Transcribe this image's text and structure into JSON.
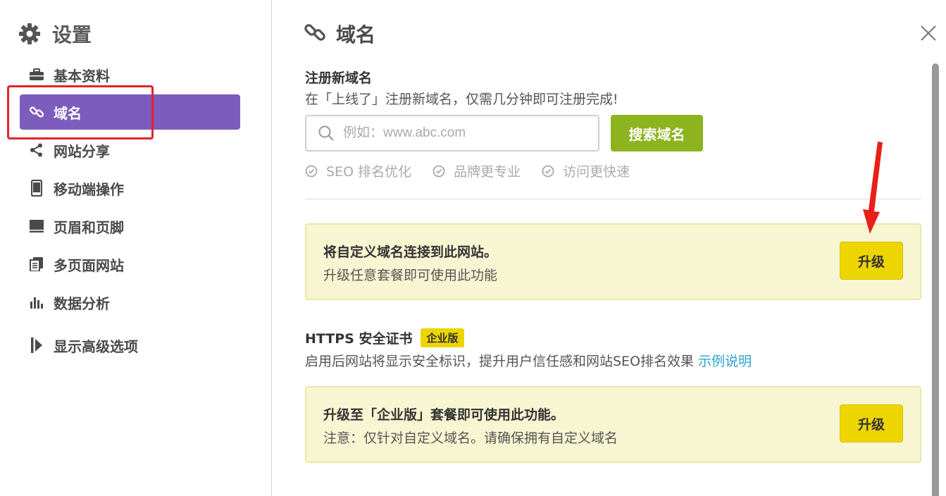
{
  "sidebar": {
    "title": "设置",
    "items": [
      {
        "label": "基本资料",
        "icon": "briefcase-icon"
      },
      {
        "label": "域名",
        "icon": "link-icon",
        "active": true
      },
      {
        "label": "网站分享",
        "icon": "share-icon"
      },
      {
        "label": "移动端操作",
        "icon": "mobile-icon"
      },
      {
        "label": "页眉和页脚",
        "icon": "header-footer-icon"
      },
      {
        "label": "多页面网站",
        "icon": "pages-icon"
      },
      {
        "label": "数据分析",
        "icon": "bar-chart-icon"
      },
      {
        "label": "显示高级选项",
        "icon": "expand-icon"
      }
    ]
  },
  "main": {
    "title": "域名",
    "register": {
      "title": "注册新域名",
      "desc": "在「上线了」注册新域名，仅需几分钟即可注册完成!",
      "search_placeholder": "例如：www.abc.com",
      "search_button": "搜索域名",
      "features": [
        "SEO 排名优化",
        "品牌更专业",
        "访问更快速"
      ]
    },
    "custom_domain_card": {
      "title": "将自定义域名连接到此网站。",
      "desc": "升级任意套餐即可使用此功能",
      "button": "升级"
    },
    "https": {
      "title": "HTTPS 安全证书",
      "badge": "企业版",
      "desc": "启用后网站将显示安全标识，提升用户信任感和网站SEO排名效果",
      "link": "示例说明"
    },
    "https_card": {
      "title": "升级至「企业版」套餐即可使用此功能。",
      "desc": "注意：仅针对自定义域名。请确保拥有自定义域名",
      "button": "升级"
    }
  },
  "colors": {
    "accent": "#7c5cbd",
    "search_button": "#8db31f",
    "upgrade_button": "#edd500",
    "highlight": "#e3232c",
    "link": "#2aa3cf"
  }
}
